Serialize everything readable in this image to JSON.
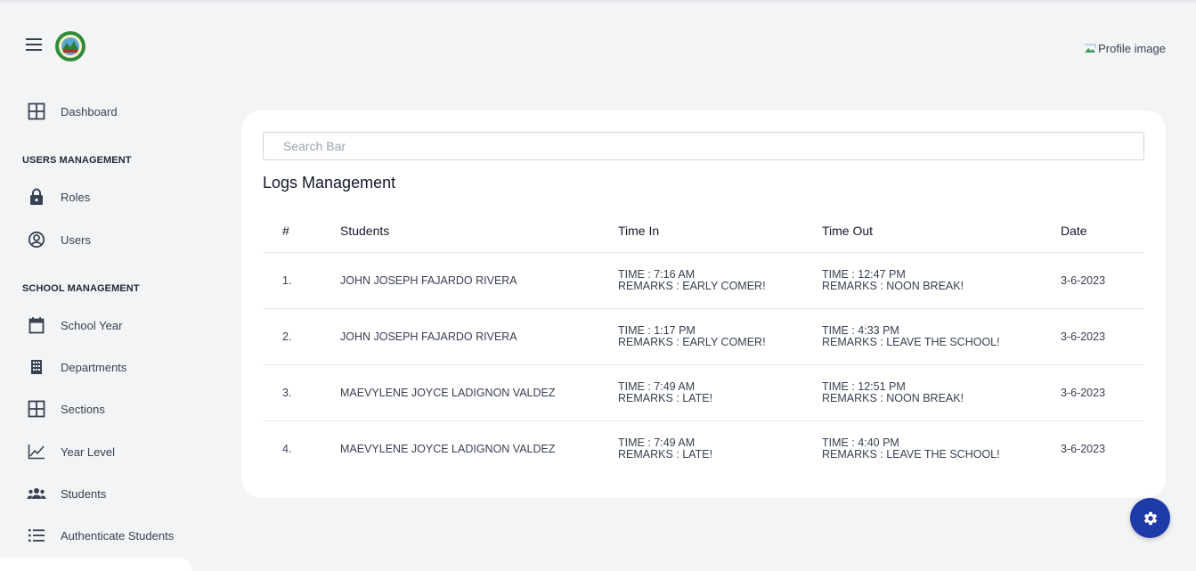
{
  "header": {
    "profile_alt": "Profile image"
  },
  "sidebar": {
    "dashboard": "Dashboard",
    "users_section": "USERS MANAGEMENT",
    "roles": "Roles",
    "users": "Users",
    "school_section": "SCHOOL MANAGEMENT",
    "school_year": "School Year",
    "departments": "Departments",
    "sections": "Sections",
    "year_level": "Year Level",
    "students": "Students",
    "authenticate_students": "Authenticate Students"
  },
  "main": {
    "search_placeholder": "Search Bar",
    "title": "Logs Management",
    "columns": [
      "#",
      "Students",
      "Time In",
      "Time Out",
      "Date"
    ],
    "rows": [
      {
        "num": "1.",
        "student": "JOHN JOSEPH FAJARDO RIVERA",
        "time_in": "TIME : 7:16 AM",
        "in_remarks": "REMARKS : EARLY COMER!",
        "time_out": "TIME : 12:47 PM",
        "out_remarks": "REMARKS : NOON BREAK!",
        "date": "3-6-2023"
      },
      {
        "num": "2.",
        "student": "JOHN JOSEPH FAJARDO RIVERA",
        "time_in": "TIME : 1:17 PM",
        "in_remarks": "REMARKS : EARLY COMER!",
        "time_out": "TIME : 4:33 PM",
        "out_remarks": "REMARKS : LEAVE THE SCHOOL!",
        "date": "3-6-2023"
      },
      {
        "num": "3.",
        "student": "MAEVYLENE JOYCE LADIGNON VALDEZ",
        "time_in": "TIME : 7:49 AM",
        "in_remarks": "REMARKS : LATE!",
        "time_out": "TIME : 12:51 PM",
        "out_remarks": "REMARKS : NOON BREAK!",
        "date": "3-6-2023"
      },
      {
        "num": "4.",
        "student": "MAEVYLENE JOYCE LADIGNON VALDEZ",
        "time_in": "TIME : 7:49 AM",
        "in_remarks": "REMARKS : LATE!",
        "time_out": "TIME : 4:40 PM",
        "out_remarks": "REMARKS : LEAVE THE SCHOOL!",
        "date": "3-6-2023"
      }
    ]
  },
  "colors": {
    "accent": "#1e3aa8",
    "background": "#f3f4f6",
    "card": "#ffffff"
  }
}
